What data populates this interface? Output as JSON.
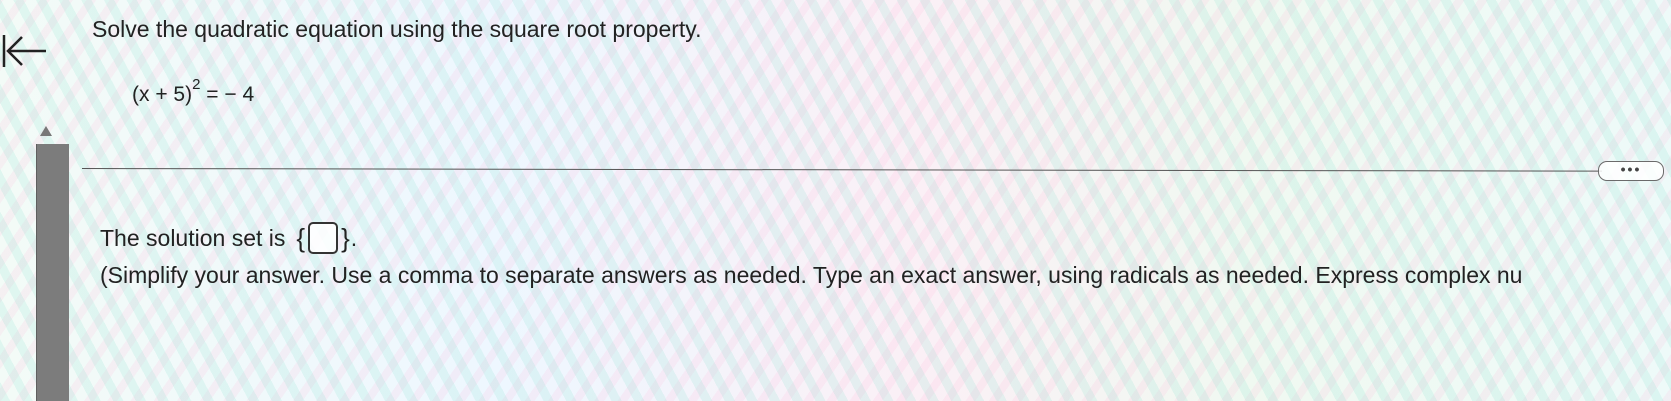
{
  "problem": {
    "title": "Solve the quadratic equation using the square root property.",
    "equation_base": "(x + 5)",
    "equation_exponent": "2",
    "equation_rhs": "= − 4"
  },
  "answer": {
    "prefix": "The solution set is",
    "open_brace": "{",
    "close_brace": "}",
    "suffix": ".",
    "value": ""
  },
  "instructions": {
    "text": "(Simplify your answer. Use a comma to separate answers as needed. Type an exact answer, using radicals as needed. Express complex nu"
  },
  "controls": {
    "more_label": "•••"
  },
  "icons": {
    "back": "left-arrow-icon",
    "scroll_up": "triangle-up-icon"
  },
  "colors": {
    "text": "#222222",
    "scrollbar": "#7c7c7c"
  }
}
